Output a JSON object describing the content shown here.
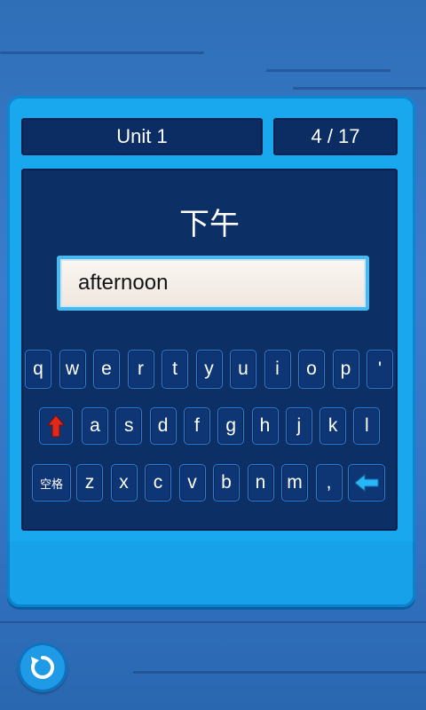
{
  "header": {
    "unit": "Unit 1",
    "progress": "4 / 17"
  },
  "prompt": {
    "word": "下午"
  },
  "answer": {
    "value": "afternoon"
  },
  "keyboard": {
    "row1": [
      "q",
      "w",
      "e",
      "r",
      "t",
      "y",
      "u",
      "i",
      "o",
      "p",
      "'"
    ],
    "row2": [
      "a",
      "s",
      "d",
      "f",
      "g",
      "h",
      "j",
      "k",
      "l"
    ],
    "row3": [
      "z",
      "x",
      "c",
      "v",
      "b",
      "n",
      "m",
      ","
    ],
    "space_label": "空格",
    "shift_icon": "shift-up-arrow-icon",
    "backspace_icon": "backspace-left-arrow-icon"
  },
  "footer": {
    "refresh_icon": "refresh-icon"
  },
  "colors": {
    "frame": "#19a8ee",
    "panel": "#0c2f66",
    "shift_arrow": "#e0281c",
    "backspace_arrow": "#29b6f6"
  }
}
